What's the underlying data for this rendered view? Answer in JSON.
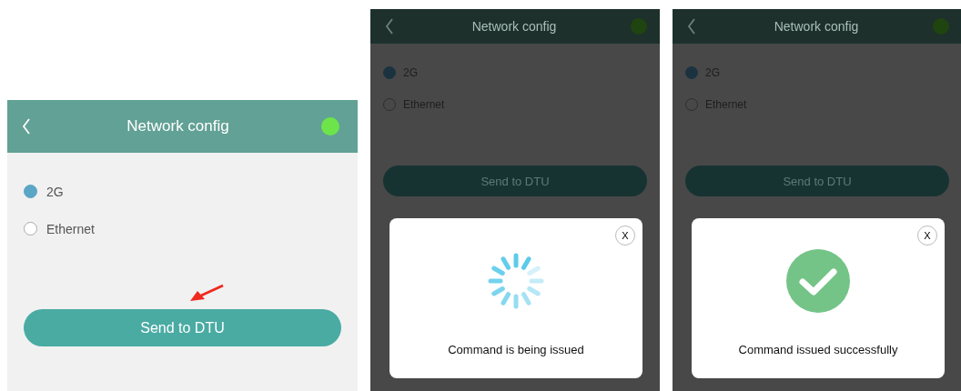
{
  "screens": [
    {
      "dimmed": false,
      "pointer_arrow": true,
      "title": "Network config",
      "options": [
        {
          "label": "2G",
          "selected": true
        },
        {
          "label": "Ethernet",
          "selected": false
        }
      ],
      "button": "Send to DTU"
    },
    {
      "dimmed": true,
      "pointer_arrow": false,
      "title": "Network config",
      "options": [
        {
          "label": "2G",
          "selected": true
        },
        {
          "label": "Ethernet",
          "selected": false
        }
      ],
      "button": "Send to DTU",
      "dialog": {
        "kind": "loading",
        "close": "X",
        "message": "Command is being issued"
      }
    },
    {
      "dimmed": true,
      "pointer_arrow": false,
      "title": "Network config",
      "options": [
        {
          "label": "2G",
          "selected": true
        },
        {
          "label": "Ethernet",
          "selected": false
        }
      ],
      "button": "Send to DTU",
      "dialog": {
        "kind": "success",
        "close": "X",
        "message": "Command issued successfully"
      }
    }
  ]
}
